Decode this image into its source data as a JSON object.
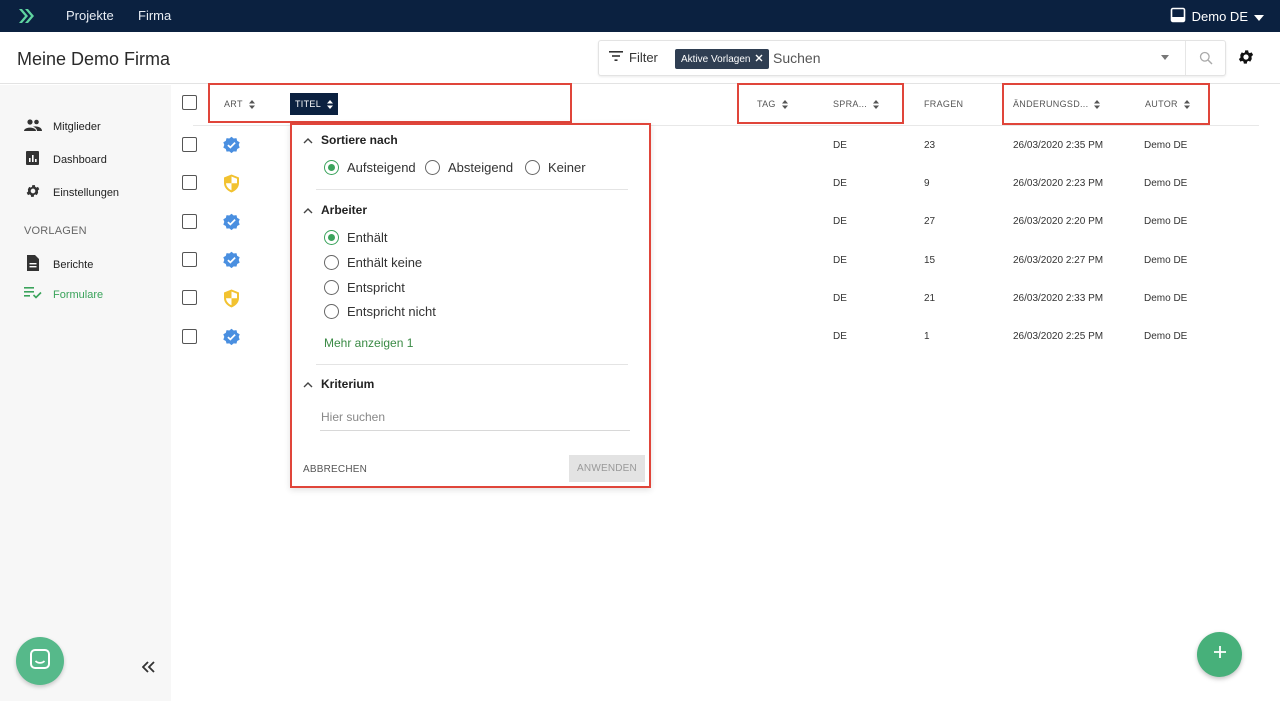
{
  "topbar": {
    "nav": [
      {
        "label": "Projekte"
      },
      {
        "label": "Firma"
      }
    ],
    "user": "Demo DE"
  },
  "header": {
    "title": "Meine Demo Firma",
    "filter_label": "Filter",
    "active_chip": "Aktive Vorlagen",
    "search_placeholder": "Suchen"
  },
  "sidebar": {
    "items": [
      {
        "label": "Mitglieder",
        "icon": "people-icon"
      },
      {
        "label": "Dashboard",
        "icon": "chart-icon"
      },
      {
        "label": "Einstellungen",
        "icon": "gear-icon"
      }
    ],
    "section_label": "VORLAGEN",
    "templates": [
      {
        "label": "Berichte",
        "icon": "document-icon"
      },
      {
        "label": "Formulare",
        "icon": "checklist-icon",
        "active": true
      }
    ]
  },
  "table": {
    "columns": {
      "art": "ART",
      "titel": "TITEL",
      "tag": "TAG",
      "sprache": "SPRA...",
      "fragen": "FRAGEN",
      "aenderung": "ÄNDERUNGSD...",
      "autor": "AUTOR"
    },
    "rows": [
      {
        "type": "verified",
        "sprache": "DE",
        "fragen": "23",
        "datum": "26/03/2020 2:35 PM",
        "autor": "Demo DE"
      },
      {
        "type": "shield",
        "sprache": "DE",
        "fragen": "9",
        "datum": "26/03/2020 2:23 PM",
        "autor": "Demo DE"
      },
      {
        "type": "verified",
        "sprache": "DE",
        "fragen": "27",
        "datum": "26/03/2020 2:20 PM",
        "autor": "Demo DE"
      },
      {
        "type": "verified",
        "sprache": "DE",
        "fragen": "15",
        "datum": "26/03/2020 2:27 PM",
        "autor": "Demo DE"
      },
      {
        "type": "shield",
        "sprache": "DE",
        "fragen": "21",
        "datum": "26/03/2020 2:33 PM",
        "autor": "Demo DE"
      },
      {
        "type": "verified",
        "sprache": "DE",
        "fragen": "1",
        "datum": "26/03/2020 2:25 PM",
        "autor": "Demo DE"
      }
    ]
  },
  "popover": {
    "sort_title": "Sortiere nach",
    "sort_options": [
      "Aufsteigend",
      "Absteigend",
      "Keiner"
    ],
    "sort_selected": "Aufsteigend",
    "worker_title": "Arbeiter",
    "worker_options": [
      "Enthält",
      "Enthält keine",
      "Entspricht",
      "Entspricht nicht"
    ],
    "worker_selected": "Enthält",
    "more_label": "Mehr anzeigen 1",
    "criterion_title": "Kriterium",
    "criterion_placeholder": "Hier suchen",
    "cancel_label": "ABBRECHEN",
    "apply_label": "ANWENDEN"
  },
  "colors": {
    "topbar": "#0b2140",
    "accent_green": "#3aa35b",
    "highlight_red": "#e0453a",
    "verified_blue": "#4a8fe0",
    "shield_yellow": "#f2c230"
  }
}
